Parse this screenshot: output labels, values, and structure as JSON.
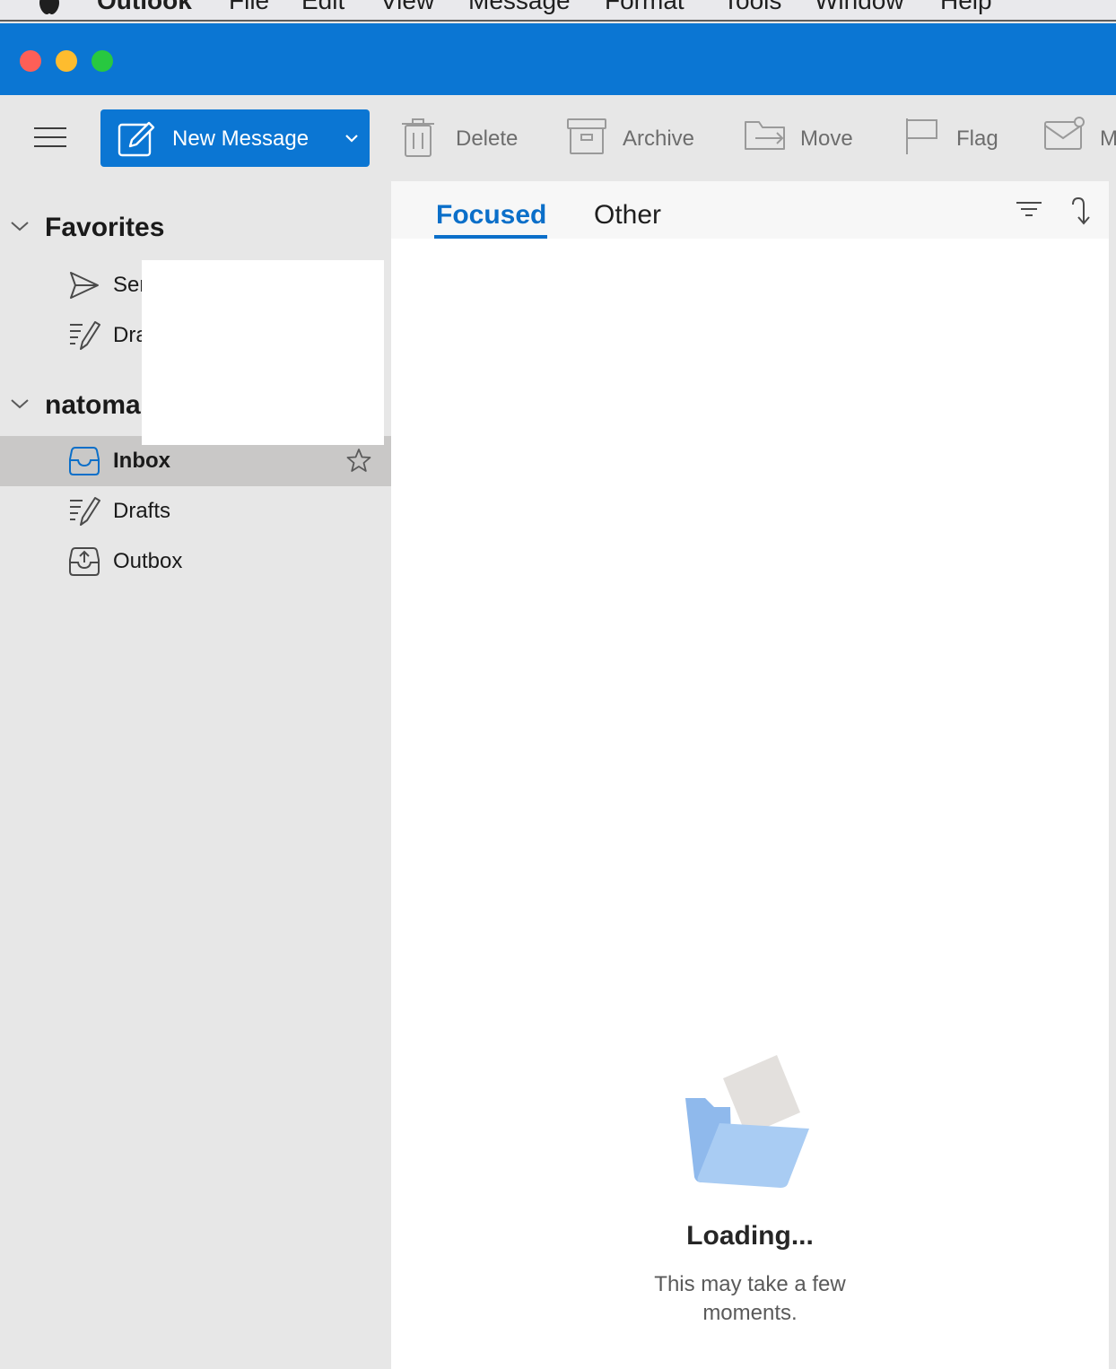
{
  "menubar": {
    "app_name": "Outlook",
    "items": [
      "File",
      "Edit",
      "View",
      "Message",
      "Format",
      "Tools",
      "Window",
      "Help"
    ]
  },
  "toolbar": {
    "new_message_label": "New Message",
    "delete_label": "Delete",
    "archive_label": "Archive",
    "move_label": "Move",
    "flag_label": "Flag",
    "overflow_label": "M"
  },
  "sidebar": {
    "favorites": {
      "title": "Favorites",
      "items": [
        {
          "label": "Ser",
          "icon": "send-icon"
        },
        {
          "label": "Dra",
          "icon": "drafts-icon"
        }
      ]
    },
    "account": {
      "title": "natoma",
      "items": [
        {
          "label": "Inbox",
          "icon": "inbox-icon",
          "selected": true
        },
        {
          "label": "Drafts",
          "icon": "drafts-icon"
        },
        {
          "label": "Outbox",
          "icon": "outbox-icon"
        }
      ]
    }
  },
  "message_list": {
    "tabs": [
      {
        "label": "Focused",
        "active": true
      },
      {
        "label": "Other",
        "active": false
      }
    ],
    "loading_title": "Loading...",
    "loading_subtitle": "This may take a few moments."
  },
  "colors": {
    "accent": "#0b76d3",
    "sidebar_bg": "#e7e7e7",
    "selected_bg": "#c9c8c7"
  }
}
